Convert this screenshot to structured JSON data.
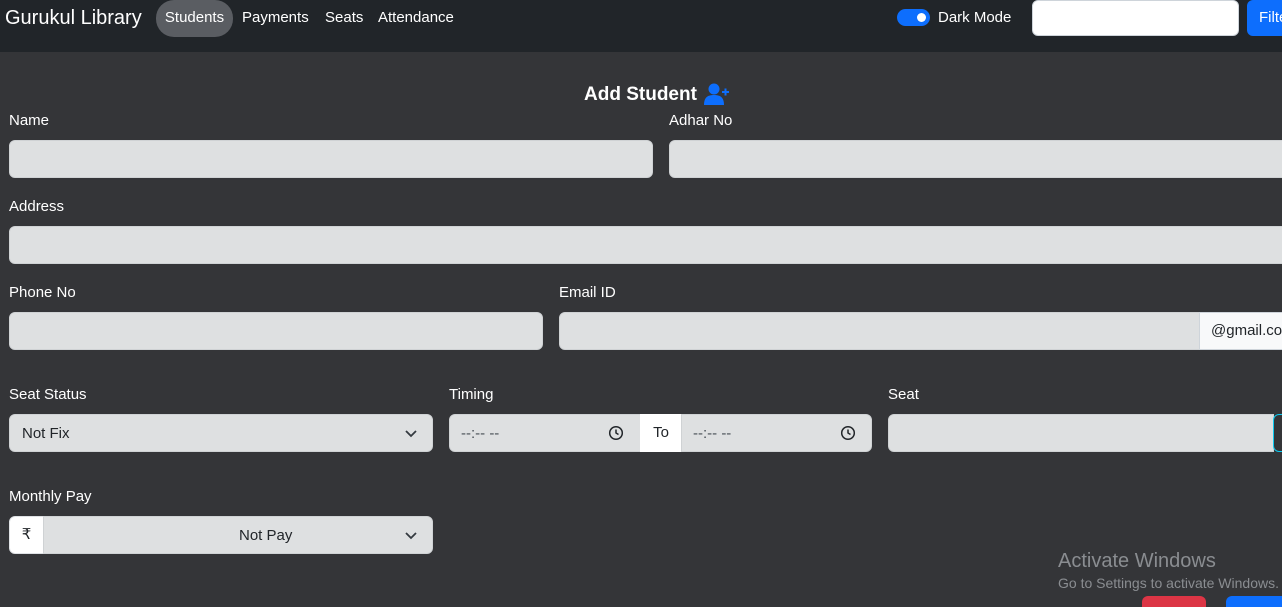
{
  "navbar": {
    "brand": "Gurukul Library",
    "links": [
      "Students",
      "Payments",
      "Seats",
      "Attendance"
    ],
    "active_link": "Students",
    "dark_mode_label": "Dark Mode",
    "dark_mode_on": true,
    "search_value": "",
    "filter_button": "Filter"
  },
  "form": {
    "title": "Add Student",
    "title_icon": "user-plus-icon",
    "name_label": "Name",
    "name_value": "",
    "adhar_label": "Adhar No",
    "adhar_value": "",
    "address_label": "Address",
    "address_value": "",
    "phone_label": "Phone No",
    "phone_value": "",
    "email_label": "Email ID",
    "email_value": "",
    "email_suffix": "@gmail.com",
    "seat_status_label": "Seat Status",
    "seat_status_value": "Not Fix",
    "timing_label": "Timing",
    "timing_from_placeholder": "--:-- --",
    "timing_to_label": "To",
    "timing_to_placeholder": "--:-- --",
    "seat_label": "Seat",
    "seat_value": "",
    "monthly_pay_label": "Monthly Pay",
    "currency_symbol": "₹",
    "monthly_pay_value": "Not Pay"
  },
  "watermark": {
    "line1": "Activate Windows",
    "line2": "Go to Settings to activate Windows."
  },
  "colors": {
    "background": "#343538",
    "navbar": "#212529",
    "accent": "#0d6efd",
    "danger": "#dc3545",
    "input_bg": "#dee0e1"
  }
}
